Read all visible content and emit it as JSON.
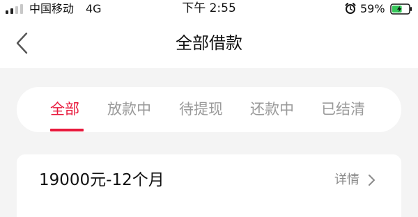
{
  "status_bar": {
    "carrier": "中国移动",
    "network": "4G",
    "time": "下午 2:55",
    "battery_percent": "59%",
    "battery_level": 0.59,
    "icons": [
      "signal-icon",
      "alarm-icon",
      "battery-icon"
    ]
  },
  "nav": {
    "title": "全部借款",
    "back_icon": "chevron-left-icon"
  },
  "tabs": [
    {
      "label": "全部",
      "active": true
    },
    {
      "label": "放款中",
      "active": false
    },
    {
      "label": "待提现",
      "active": false
    },
    {
      "label": "还款中",
      "active": false
    },
    {
      "label": "已结清",
      "active": false
    }
  ],
  "loan": {
    "title": "19000元-12个月",
    "details_label": "详情",
    "details_icon": "chevron-right-icon"
  },
  "colors": {
    "accent": "#e8193c",
    "page_background": "#f4f4f4",
    "card_background": "#ffffff",
    "inactive_text": "#9a9a9a",
    "battery_green": "#35c759"
  }
}
